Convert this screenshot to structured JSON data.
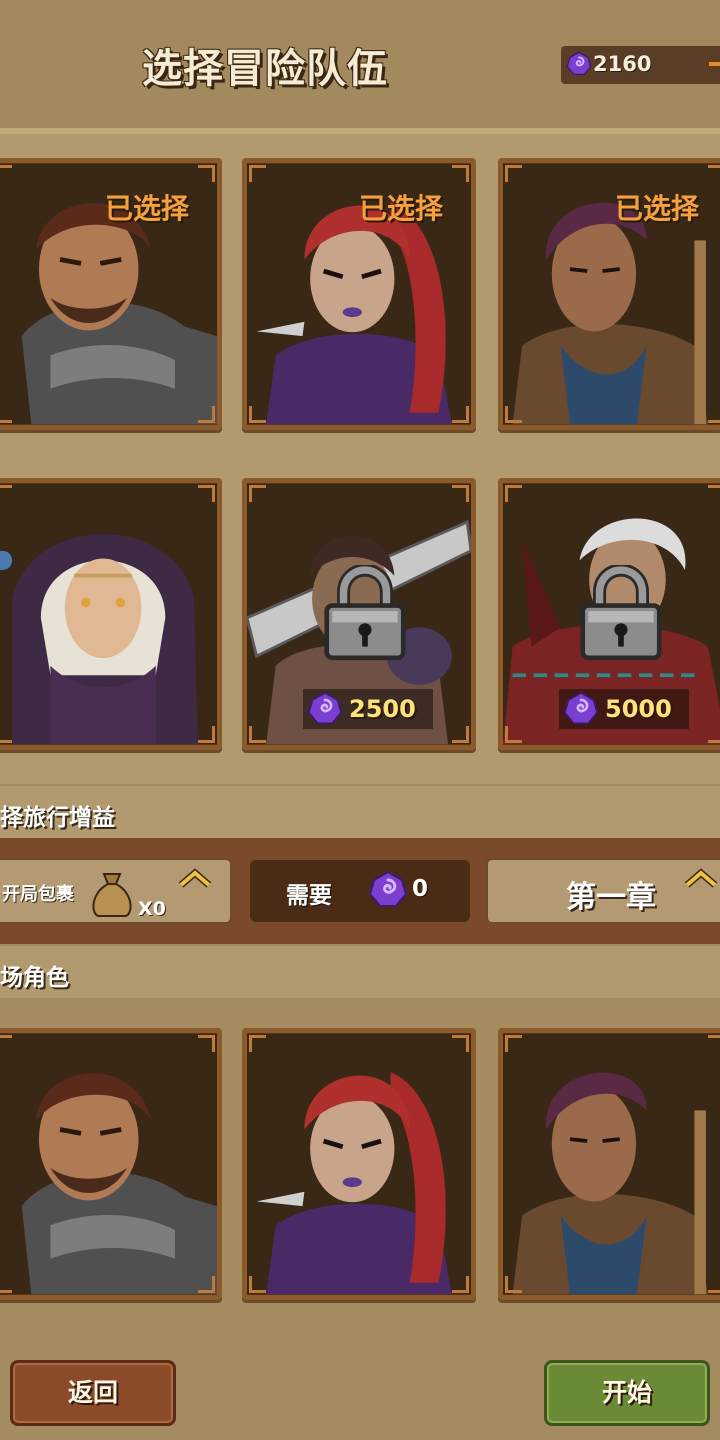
{
  "header": {
    "title": "选择冒险队伍",
    "gem_count": "2160",
    "gem_icon": "purple-spiral-gem-icon"
  },
  "hero_pool": [
    {
      "name": "warrior",
      "status": "已选择"
    },
    {
      "name": "rogue",
      "status": "已选择"
    },
    {
      "name": "shaman",
      "status": "已选择"
    },
    {
      "name": "nun",
      "status": ""
    },
    {
      "name": "swordsman",
      "status": "",
      "locked": true,
      "price": "2500"
    },
    {
      "name": "elder-mage",
      "status": "",
      "locked": true,
      "price": "5000"
    }
  ],
  "travel_buff": {
    "section_label": "择旅行增益",
    "item_label": "开局包裹",
    "item_count": "X0",
    "need_label": "需要",
    "need_value": "0",
    "chapter_label": "第一章"
  },
  "deploy": {
    "section_label": "场角色",
    "heroes": [
      "warrior",
      "rogue",
      "shaman"
    ]
  },
  "buttons": {
    "back": "返回",
    "start": "开始"
  },
  "colors": {
    "gem": "#7a3fd1",
    "selected_text": "#f6a23c",
    "price_text": "#ffe27a",
    "start_button": "#6a8a36",
    "back_button": "#8b4a2a"
  }
}
